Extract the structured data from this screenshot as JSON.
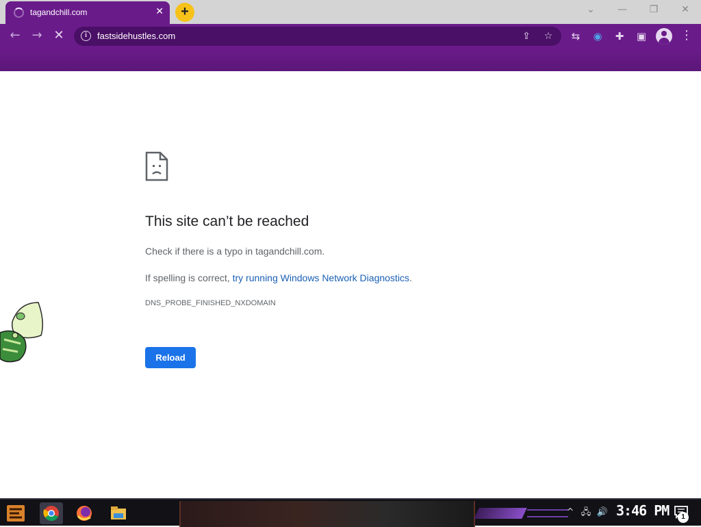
{
  "browser": {
    "tab": {
      "title": "tagandchill.com",
      "close_glyph": "✕"
    },
    "new_tab_glyph": "+",
    "window_controls": {
      "dropdown": "⌄",
      "minimize": "—",
      "restore": "❐",
      "close": "✕"
    },
    "nav": {
      "back_glyph": "←",
      "forward_glyph": "→",
      "stop_glyph": "✕"
    },
    "omnibox": {
      "url": "fastsidehustles.com",
      "info_glyph": "i",
      "share_glyph": "⇪",
      "bookmark_glyph": "☆"
    },
    "extensions": {
      "swap_glyph": "⇆",
      "shield_glyph": "◉",
      "puzzle_glyph": "✚",
      "sidepanel_glyph": "▣"
    },
    "menu_glyph": "⋮",
    "theme_color": "#6a1b8a"
  },
  "error_page": {
    "title": "This site can’t be reached",
    "line1": "Check if there is a typo in tagandchill.com.",
    "line2_prefix": "If spelling is correct, ",
    "line2_link": "try running Windows Network Diagnostics",
    "line2_suffix": ".",
    "error_code": "DNS_PROBE_FINISHED_NXDOMAIN",
    "reload_label": "Reload",
    "accent_color": "#1a73e8"
  },
  "taskbar": {
    "apps": [
      "chrome-icon",
      "firefox-icon",
      "file-explorer-icon"
    ],
    "tray": {
      "chevron_glyph": "^",
      "network_glyph": "🖧",
      "volume_glyph": "🔊"
    },
    "clock": "3:46 PM",
    "notification_count": "1"
  }
}
